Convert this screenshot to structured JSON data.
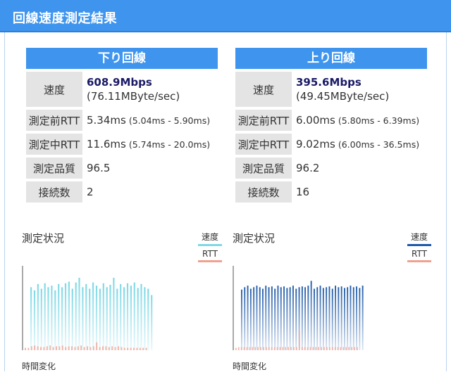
{
  "header": {
    "title": "回線速度測定結果"
  },
  "labels": {
    "speed": "速度",
    "rtt_before": "測定前RTT",
    "rtt_during": "測定中RTT",
    "quality": "測定品質",
    "connections": "接続数"
  },
  "download": {
    "title": "下り回線",
    "speed_mbps": "608.9Mbps",
    "speed_mbyte": "(76.11MByte/sec)",
    "rtt_before": "5.34ms",
    "rtt_before_range": "(5.04ms - 5.90ms)",
    "rtt_during": "11.6ms",
    "rtt_during_range": "(5.74ms - 20.0ms)",
    "quality": "96.5",
    "connections": "2",
    "chart": {
      "title": "測定状況",
      "legend_speed": "速度",
      "legend_rtt": "RTT",
      "xlabel": "時間変化",
      "speed_color": "#7fd8e6",
      "rtt_color": "#f0a090"
    }
  },
  "upload": {
    "title": "上り回線",
    "speed_mbps": "395.6Mbps",
    "speed_mbyte": "(49.45MByte/sec)",
    "rtt_before": "6.00ms",
    "rtt_before_range": "(5.80ms - 6.39ms)",
    "rtt_during": "9.02ms",
    "rtt_during_range": "(6.00ms - 36.5ms)",
    "quality": "96.2",
    "connections": "16",
    "chart": {
      "title": "測定状況",
      "legend_speed": "速度",
      "legend_rtt": "RTT",
      "xlabel": "時間変化",
      "speed_color": "#1f5aa8",
      "rtt_color": "#f0a090"
    }
  },
  "chart_data": [
    {
      "type": "bar",
      "title": "測定状況",
      "xlabel": "時間変化",
      "ylim": [
        0,
        1
      ],
      "series": [
        {
          "name": "速度",
          "values": [
            0.8,
            0.76,
            0.84,
            0.78,
            0.85,
            0.8,
            0.82,
            0.76,
            0.84,
            0.8,
            0.85,
            0.87,
            0.78,
            0.86,
            0.92,
            0.8,
            0.84,
            0.78,
            0.86,
            0.82,
            0.78,
            0.85,
            0.8,
            0.83,
            0.92,
            0.78,
            0.84,
            0.8,
            0.85,
            0.82,
            0.86,
            0.79,
            0.84,
            0.8,
            0.78,
            0.7
          ]
        },
        {
          "name": "RTT",
          "values": [
            0.03,
            0.03,
            0.05,
            0.06,
            0.05,
            0.04,
            0.04,
            0.05,
            0.06,
            0.04,
            0.05,
            0.05,
            0.06,
            0.04,
            0.05,
            0.05,
            0.04,
            0.05,
            0.06,
            0.04,
            0.05,
            0.04,
            0.05,
            0.1,
            0.04,
            0.05,
            0.05,
            0.04,
            0.05,
            0.04,
            0.05,
            0.04,
            0.03,
            0.03,
            0.03,
            0.03
          ]
        }
      ]
    },
    {
      "type": "bar",
      "title": "測定状況",
      "xlabel": "時間変化",
      "ylim": [
        0,
        1
      ],
      "series": [
        {
          "name": "速度",
          "values": [
            0.77,
            0.8,
            0.82,
            0.78,
            0.8,
            0.82,
            0.8,
            0.78,
            0.82,
            0.8,
            0.81,
            0.78,
            0.82,
            0.8,
            0.81,
            0.79,
            0.8,
            0.82,
            0.78,
            0.8,
            0.81,
            0.8,
            0.82,
            0.88,
            0.78,
            0.8,
            0.82,
            0.79,
            0.8,
            0.81,
            0.78,
            0.82,
            0.8,
            0.81,
            0.79,
            0.8,
            0.82,
            0.8,
            0.81,
            0.79,
            0.82
          ]
        },
        {
          "name": "RTT",
          "values": [
            0.03,
            0.04,
            0.04,
            0.04,
            0.04,
            0.04,
            0.04,
            0.04,
            0.04,
            0.04,
            0.04,
            0.04,
            0.04,
            0.04,
            0.04,
            0.04,
            0.04,
            0.04,
            0.04,
            0.04,
            0.04,
            0.04,
            0.04,
            0.25,
            0.04,
            0.04,
            0.04,
            0.04,
            0.04,
            0.04,
            0.04,
            0.04,
            0.04,
            0.04,
            0.04,
            0.04,
            0.04,
            0.04,
            0.04,
            0.04,
            0.04
          ]
        }
      ]
    }
  ]
}
